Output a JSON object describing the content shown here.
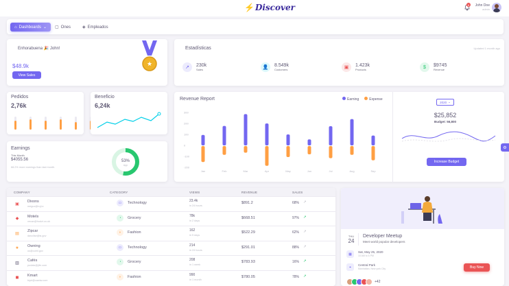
{
  "topbar": {
    "logo": "Discover",
    "user_name": "John Doe",
    "user_role": "admin",
    "notification_count": "6"
  },
  "nav": {
    "dashboards": "Dashboards",
    "ones": "Ones",
    "empleados": "Empleados"
  },
  "congrats": {
    "title": "Enhorabuena",
    "name": "John!",
    "amount": "$48.9k",
    "button": "View Sales"
  },
  "stats": {
    "title": "Estadísticas",
    "updated": "Updated 1 month ago",
    "items": [
      {
        "value": "230k",
        "label": "Sales",
        "color": "#7367f0"
      },
      {
        "value": "8.549k",
        "label": "Customers",
        "color": "#00cfe8"
      },
      {
        "value": "1.423k",
        "label": "Products",
        "color": "#ea5455"
      },
      {
        "value": "$9745",
        "label": "Revenue",
        "color": "#28c76f"
      }
    ]
  },
  "pedidos": {
    "title": "Pedidos",
    "value": "2,76k",
    "bar_levels": [
      0.7,
      0.8,
      0.7,
      0.8,
      0.6,
      0.7
    ]
  },
  "beneficio": {
    "title": "Beneficio",
    "value": "6,24k"
  },
  "earnings": {
    "title": "Earnings",
    "subtitle": "This Month",
    "amount": "$4055.56",
    "note": "68.2% more earnings than last month.",
    "donut_value": "53%",
    "donut_label": "App",
    "donut_fraction": 0.53
  },
  "revenue": {
    "title": "Revenue Report",
    "legend_earning": "Earning",
    "legend_expense": "Expense",
    "year": "2020",
    "total": "$25,852",
    "budget": "Budget: 56,800",
    "button": "Increase Budget"
  },
  "chart_data": {
    "type": "bar",
    "categories": [
      "Jan",
      "Feb",
      "Mar",
      "Apr",
      "May",
      "Jun",
      "Jul",
      "Aug",
      "Sep"
    ],
    "y_ticks": [
      "300",
      "200",
      "100",
      "0",
      "-100",
      "-200"
    ],
    "ylim": [
      -200,
      300
    ],
    "series": [
      {
        "name": "Earning",
        "values": [
          95,
          177,
          285,
          200,
          100,
          55,
          175,
          240,
          90
        ],
        "color": "#7367f0"
      },
      {
        "name": "Expense",
        "values": [
          -145,
          -80,
          -60,
          -180,
          -100,
          -75,
          -110,
          -80,
          -130
        ],
        "color": "#ff9f43"
      }
    ]
  },
  "table": {
    "headers": [
      "COMPANY",
      "CATEGORY",
      "VIEWS",
      "REVENUE",
      "SALES"
    ],
    "rows": [
      {
        "company": "Dixons",
        "email": "meguc@ruj.io",
        "category": "Technology",
        "views": "23.4k",
        "views_sub": "in 24 hours",
        "revenue": "$891.2",
        "sales": "68%",
        "icon": "#ea5455",
        "cat_color": "#7367f0"
      },
      {
        "company": "Motels",
        "email": "vecav@hodzi.co.uk",
        "category": "Grocery",
        "views": "78k",
        "views_sub": "in 2 days",
        "revenue": "$668.51",
        "sales": "97%",
        "icon": "#ea5455",
        "cat_color": "#28c76f"
      },
      {
        "company": "Zipcar",
        "email": "davcilse@is.gov",
        "category": "Fashion",
        "views": "162",
        "views_sub": "in 5 days",
        "revenue": "$522.29",
        "sales": "62%",
        "icon": "#ff9f43",
        "cat_color": "#ff9f43"
      },
      {
        "company": "Owning",
        "email": "us@cuhil.gov",
        "category": "Technology",
        "views": "214",
        "views_sub": "in 24 hours",
        "revenue": "$291.01",
        "sales": "88%",
        "icon": "#ff9f43",
        "cat_color": "#7367f0"
      },
      {
        "company": "Cafés",
        "email": "pudais@jife.com",
        "category": "Grocery",
        "views": "208",
        "views_sub": "in 1 week",
        "revenue": "$783.93",
        "sales": "16%",
        "icon": "#5e5873",
        "cat_color": "#28c76f"
      },
      {
        "company": "Kmart",
        "email": "bipri@cawiw.com",
        "category": "Fashion",
        "views": "990",
        "views_sub": "in 1 month",
        "revenue": "$780.05",
        "sales": "78%",
        "icon": "#ea5455",
        "cat_color": "#ff9f43"
      }
    ]
  },
  "meetup": {
    "day": "THU",
    "date": "24",
    "title": "Developer Meetup",
    "subtitle": "Meet world popular developers",
    "when": "Sat, May 25, 2020",
    "time": "10 AM to 6 PM",
    "place": "Central Park",
    "city": "Manhattan, New york City",
    "more": "+42",
    "button": "Buy Now"
  }
}
